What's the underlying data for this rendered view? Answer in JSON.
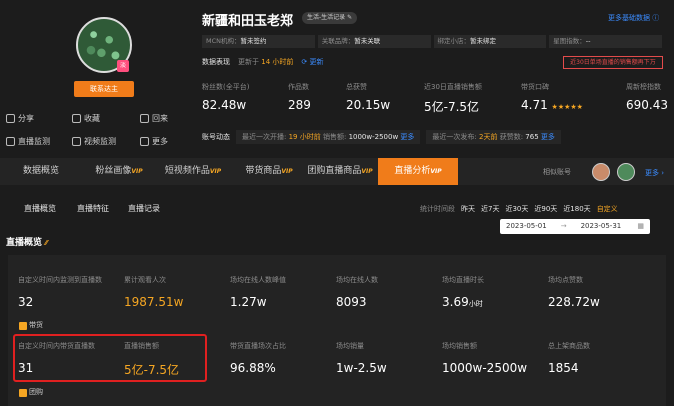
{
  "profile": {
    "name": "新疆和田玉老郑",
    "tag": "生活-生活记录",
    "avatar_badge": "淡",
    "contact_label": "联系达主",
    "actions": [
      {
        "icon": "share-icon",
        "label": "分享"
      },
      {
        "icon": "star-icon",
        "label": "收藏"
      },
      {
        "icon": "back-icon",
        "label": "回来"
      },
      {
        "icon": "monitor-icon",
        "label": "直播监测"
      },
      {
        "icon": "video-icon",
        "label": "视频监测"
      },
      {
        "icon": "more-icon",
        "label": "更多"
      }
    ]
  },
  "header": {
    "more_basic": "更多基础数据",
    "info": [
      {
        "label": "MCN机构：",
        "value": "暂未签约"
      },
      {
        "label": "关联品牌：",
        "value": "暂未关联"
      },
      {
        "label": "绑定小店：",
        "value": "暂未绑定"
      },
      {
        "label": "星图指数：",
        "value": "--"
      }
    ],
    "data_label": "数据表现",
    "update_prefix": "更新于",
    "update_time": "14 小时前",
    "refresh": "更新",
    "warning": "近30日单场直播的销售额再下万"
  },
  "metrics": [
    {
      "label": "粉丝数(全平台)",
      "value": "82.48w"
    },
    {
      "label": "作品数",
      "value": "289"
    },
    {
      "label": "总获赞",
      "value": "20.15w"
    },
    {
      "label": "近30日直播销售额",
      "value": "5亿-7.5亿"
    },
    {
      "label": "带货口碑",
      "value": "4.71",
      "stars": "★★★★★"
    },
    {
      "label": "周新榜指数",
      "value": "690.43"
    }
  ],
  "dynamics": {
    "label": "账号动态",
    "live_prefix": "最近一次开播:",
    "live_time": "19 小时前",
    "sales_label": "销售额:",
    "sales_value": "1000w-2500w",
    "more1": "更多",
    "post_prefix": "最近一次发布:",
    "post_time": "2天前",
    "likes_label": "获赞数:",
    "likes_value": "765",
    "more2": "更多"
  },
  "main_tabs": [
    {
      "label": "数据概览",
      "vip": ""
    },
    {
      "label": "粉丝画像",
      "vip": "VIP"
    },
    {
      "label": "短视频作品",
      "vip": "VIP"
    },
    {
      "label": "带货商品",
      "vip": "VIP"
    },
    {
      "label": "团购直播商品",
      "vip": "VIP"
    },
    {
      "label": "直播分析",
      "vip": "VIP"
    }
  ],
  "similar": {
    "label": "相似账号",
    "more": "更多"
  },
  "sub_tabs": [
    "直播概览",
    "直播特征",
    "直播记录"
  ],
  "periods": {
    "label": "统计时间段",
    "options": [
      "昨天",
      "近7天",
      "近30天",
      "近90天",
      "近180天",
      "自定义"
    ]
  },
  "date_range": {
    "start": "2023-05-01",
    "sep": "→",
    "end": "2023-05-31"
  },
  "section_title": "直播概览",
  "row1": [
    {
      "label": "自定义时间内监测到直播数",
      "value": "32"
    },
    {
      "label": "累计观看人次",
      "value": "1987.51w"
    },
    {
      "label": "场均在线人数峰值",
      "value": "1.27w"
    },
    {
      "label": "场均在线人数",
      "value": "8093"
    },
    {
      "label": "场均直播时长",
      "value": "3.69",
      "unit": "小时"
    },
    {
      "label": "场均点赞数",
      "value": "228.72w"
    }
  ],
  "tag_daihuo": "带货",
  "row2": [
    {
      "label": "自定义时间内带货直播数",
      "value": "31"
    },
    {
      "label": "直播销售额",
      "value": "5亿-7.5亿"
    },
    {
      "label": "带货直播场次占比",
      "value": "96.88%"
    },
    {
      "label": "场均销量",
      "value": "1w-2.5w"
    },
    {
      "label": "场均销售额",
      "value": "1000w-2500w"
    },
    {
      "label": "总上架商品数",
      "value": "1854"
    }
  ],
  "tag_tuangou": "团购",
  "colors": {
    "accent": "#f07c1a",
    "highlight": "#e02020",
    "link": "#3b8cff"
  }
}
